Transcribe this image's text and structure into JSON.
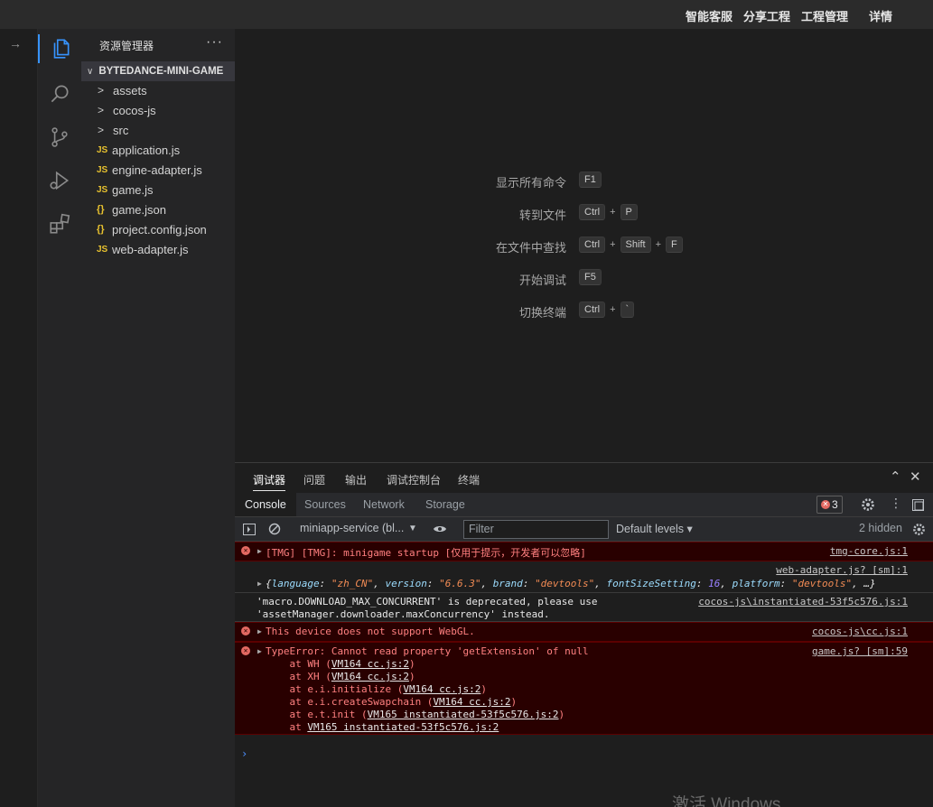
{
  "topbar": {
    "items": [
      "智能客服",
      "分享工程",
      "工程管理",
      "详情"
    ]
  },
  "explorer": {
    "title": "资源管理器",
    "more": "···",
    "root": "BYTEDANCE-MINI-GAME",
    "files": [
      {
        "type": "folder",
        "icon": ">",
        "name": "assets"
      },
      {
        "type": "folder",
        "icon": ">",
        "name": "cocos-js"
      },
      {
        "type": "folder",
        "icon": ">",
        "name": "src"
      },
      {
        "type": "js",
        "icon": "JS",
        "name": "application.js"
      },
      {
        "type": "js",
        "icon": "JS",
        "name": "engine-adapter.js"
      },
      {
        "type": "js",
        "icon": "JS",
        "name": "game.js"
      },
      {
        "type": "json",
        "icon": "{}",
        "name": "game.json"
      },
      {
        "type": "json",
        "icon": "{}",
        "name": "project.config.json"
      },
      {
        "type": "js",
        "icon": "JS",
        "name": "web-adapter.js"
      }
    ]
  },
  "welcome": {
    "commands": [
      {
        "label": "显示所有命令",
        "keys": [
          "F1"
        ]
      },
      {
        "label": "转到文件",
        "keys": [
          "Ctrl",
          "P"
        ]
      },
      {
        "label": "在文件中查找",
        "keys": [
          "Ctrl",
          "Shift",
          "F"
        ]
      },
      {
        "label": "开始调试",
        "keys": [
          "F5"
        ]
      },
      {
        "label": "切换终端",
        "keys": [
          "Ctrl",
          "`"
        ]
      }
    ],
    "plus": "+"
  },
  "panel": {
    "tabs": [
      "调试器",
      "问题",
      "输出",
      "调试控制台",
      "终端"
    ],
    "devtools_tabs": [
      "Console",
      "Sources",
      "Network",
      "Storage"
    ],
    "error_count": "3",
    "context": "miniapp-service (bl...",
    "filter_placeholder": "Filter",
    "levels": "Default levels ▾",
    "hidden": "2 hidden",
    "prompt": "›"
  },
  "console": {
    "row1": {
      "msg": "[TMG] [TMG]: minigame startup [仅用于提示，开发者可以忽略]",
      "src": "tmg-core.js:1"
    },
    "row2": {
      "src": "web-adapter.js? [sm]:1",
      "k1": "language",
      "v1": "\"zh_CN\"",
      "k2": "version",
      "v2": "\"6.6.3\"",
      "k3": "brand",
      "v3": "\"devtools\"",
      "k4": "fontSizeSetting",
      "v4": "16",
      "k5": "platform",
      "v5": "\"devtools\"",
      "tail": ", …}"
    },
    "row3": {
      "line1": "'macro.DOWNLOAD_MAX_CONCURRENT' is deprecated, please use",
      "line2": "'assetManager.downloader.maxConcurrency' instead.",
      "src": "cocos-js\\instantiated-53f5c576.js:1"
    },
    "row4": {
      "msg": "This device does not support WebGL.",
      "src": "cocos-js\\cc.js:1"
    },
    "row5": {
      "msg": "TypeError: Cannot read property 'getExtension' of null",
      "src": "game.js? [sm]:59",
      "stack": [
        {
          "pre": "    at WH (",
          "link": "VM164 cc.js:2",
          "post": ")"
        },
        {
          "pre": "    at XH (",
          "link": "VM164 cc.js:2",
          "post": ")"
        },
        {
          "pre": "    at e.i.initialize (",
          "link": "VM164 cc.js:2",
          "post": ")"
        },
        {
          "pre": "    at e.i.createSwapchain (",
          "link": "VM164 cc.js:2",
          "post": ")"
        },
        {
          "pre": "    at e.t.init (",
          "link": "VM165 instantiated-53f5c576.js:2",
          "post": ")"
        },
        {
          "pre": "    at ",
          "link": "VM165 instantiated-53f5c576.js:2",
          "post": ""
        }
      ]
    }
  },
  "watermark": "激活 Windows",
  "colors": {
    "accent": "#3794ff",
    "error_bg": "#290000",
    "error_text": "#ff8080",
    "js_icon": "#e8c22f"
  }
}
